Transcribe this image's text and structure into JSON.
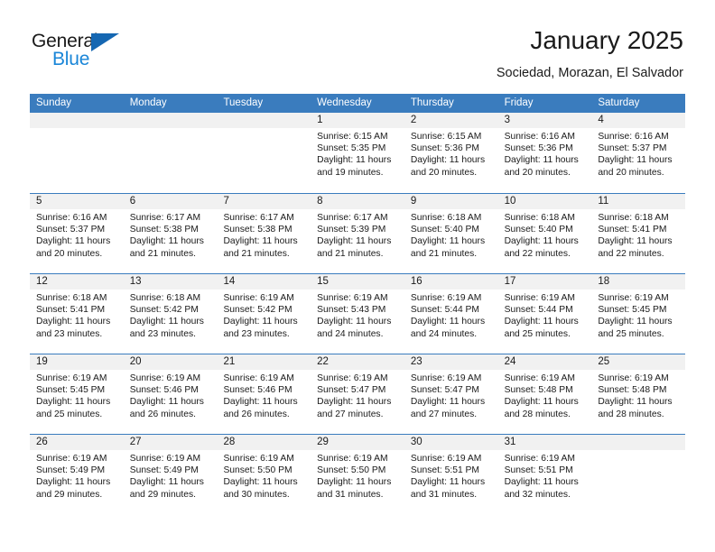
{
  "brand": {
    "name_top": "General",
    "name_bottom": "Blue",
    "triangle_color": "#1567b2",
    "blue_text_color": "#1a86d8"
  },
  "header": {
    "title": "January 2025",
    "subtitle": "Sociedad, Morazan, El Salvador"
  },
  "theme": {
    "header_band_color": "#3a7cbe",
    "daynum_band_color": "#f1f1f1",
    "text_color": "#1a1a1a"
  },
  "calendar": {
    "day_headers": [
      "Sunday",
      "Monday",
      "Tuesday",
      "Wednesday",
      "Thursday",
      "Friday",
      "Saturday"
    ],
    "weeks": [
      [
        {
          "day": "",
          "empty": true,
          "sunrise": "",
          "sunset": "",
          "daylight1": "",
          "daylight2": ""
        },
        {
          "day": "",
          "empty": true,
          "sunrise": "",
          "sunset": "",
          "daylight1": "",
          "daylight2": ""
        },
        {
          "day": "",
          "empty": true,
          "sunrise": "",
          "sunset": "",
          "daylight1": "",
          "daylight2": ""
        },
        {
          "day": "1",
          "empty": false,
          "sunrise": "Sunrise: 6:15 AM",
          "sunset": "Sunset: 5:35 PM",
          "daylight1": "Daylight: 11 hours",
          "daylight2": "and 19 minutes."
        },
        {
          "day": "2",
          "empty": false,
          "sunrise": "Sunrise: 6:15 AM",
          "sunset": "Sunset: 5:36 PM",
          "daylight1": "Daylight: 11 hours",
          "daylight2": "and 20 minutes."
        },
        {
          "day": "3",
          "empty": false,
          "sunrise": "Sunrise: 6:16 AM",
          "sunset": "Sunset: 5:36 PM",
          "daylight1": "Daylight: 11 hours",
          "daylight2": "and 20 minutes."
        },
        {
          "day": "4",
          "empty": false,
          "sunrise": "Sunrise: 6:16 AM",
          "sunset": "Sunset: 5:37 PM",
          "daylight1": "Daylight: 11 hours",
          "daylight2": "and 20 minutes."
        }
      ],
      [
        {
          "day": "5",
          "empty": false,
          "sunrise": "Sunrise: 6:16 AM",
          "sunset": "Sunset: 5:37 PM",
          "daylight1": "Daylight: 11 hours",
          "daylight2": "and 20 minutes."
        },
        {
          "day": "6",
          "empty": false,
          "sunrise": "Sunrise: 6:17 AM",
          "sunset": "Sunset: 5:38 PM",
          "daylight1": "Daylight: 11 hours",
          "daylight2": "and 21 minutes."
        },
        {
          "day": "7",
          "empty": false,
          "sunrise": "Sunrise: 6:17 AM",
          "sunset": "Sunset: 5:38 PM",
          "daylight1": "Daylight: 11 hours",
          "daylight2": "and 21 minutes."
        },
        {
          "day": "8",
          "empty": false,
          "sunrise": "Sunrise: 6:17 AM",
          "sunset": "Sunset: 5:39 PM",
          "daylight1": "Daylight: 11 hours",
          "daylight2": "and 21 minutes."
        },
        {
          "day": "9",
          "empty": false,
          "sunrise": "Sunrise: 6:18 AM",
          "sunset": "Sunset: 5:40 PM",
          "daylight1": "Daylight: 11 hours",
          "daylight2": "and 21 minutes."
        },
        {
          "day": "10",
          "empty": false,
          "sunrise": "Sunrise: 6:18 AM",
          "sunset": "Sunset: 5:40 PM",
          "daylight1": "Daylight: 11 hours",
          "daylight2": "and 22 minutes."
        },
        {
          "day": "11",
          "empty": false,
          "sunrise": "Sunrise: 6:18 AM",
          "sunset": "Sunset: 5:41 PM",
          "daylight1": "Daylight: 11 hours",
          "daylight2": "and 22 minutes."
        }
      ],
      [
        {
          "day": "12",
          "empty": false,
          "sunrise": "Sunrise: 6:18 AM",
          "sunset": "Sunset: 5:41 PM",
          "daylight1": "Daylight: 11 hours",
          "daylight2": "and 23 minutes."
        },
        {
          "day": "13",
          "empty": false,
          "sunrise": "Sunrise: 6:18 AM",
          "sunset": "Sunset: 5:42 PM",
          "daylight1": "Daylight: 11 hours",
          "daylight2": "and 23 minutes."
        },
        {
          "day": "14",
          "empty": false,
          "sunrise": "Sunrise: 6:19 AM",
          "sunset": "Sunset: 5:42 PM",
          "daylight1": "Daylight: 11 hours",
          "daylight2": "and 23 minutes."
        },
        {
          "day": "15",
          "empty": false,
          "sunrise": "Sunrise: 6:19 AM",
          "sunset": "Sunset: 5:43 PM",
          "daylight1": "Daylight: 11 hours",
          "daylight2": "and 24 minutes."
        },
        {
          "day": "16",
          "empty": false,
          "sunrise": "Sunrise: 6:19 AM",
          "sunset": "Sunset: 5:44 PM",
          "daylight1": "Daylight: 11 hours",
          "daylight2": "and 24 minutes."
        },
        {
          "day": "17",
          "empty": false,
          "sunrise": "Sunrise: 6:19 AM",
          "sunset": "Sunset: 5:44 PM",
          "daylight1": "Daylight: 11 hours",
          "daylight2": "and 25 minutes."
        },
        {
          "day": "18",
          "empty": false,
          "sunrise": "Sunrise: 6:19 AM",
          "sunset": "Sunset: 5:45 PM",
          "daylight1": "Daylight: 11 hours",
          "daylight2": "and 25 minutes."
        }
      ],
      [
        {
          "day": "19",
          "empty": false,
          "sunrise": "Sunrise: 6:19 AM",
          "sunset": "Sunset: 5:45 PM",
          "daylight1": "Daylight: 11 hours",
          "daylight2": "and 25 minutes."
        },
        {
          "day": "20",
          "empty": false,
          "sunrise": "Sunrise: 6:19 AM",
          "sunset": "Sunset: 5:46 PM",
          "daylight1": "Daylight: 11 hours",
          "daylight2": "and 26 minutes."
        },
        {
          "day": "21",
          "empty": false,
          "sunrise": "Sunrise: 6:19 AM",
          "sunset": "Sunset: 5:46 PM",
          "daylight1": "Daylight: 11 hours",
          "daylight2": "and 26 minutes."
        },
        {
          "day": "22",
          "empty": false,
          "sunrise": "Sunrise: 6:19 AM",
          "sunset": "Sunset: 5:47 PM",
          "daylight1": "Daylight: 11 hours",
          "daylight2": "and 27 minutes."
        },
        {
          "day": "23",
          "empty": false,
          "sunrise": "Sunrise: 6:19 AM",
          "sunset": "Sunset: 5:47 PM",
          "daylight1": "Daylight: 11 hours",
          "daylight2": "and 27 minutes."
        },
        {
          "day": "24",
          "empty": false,
          "sunrise": "Sunrise: 6:19 AM",
          "sunset": "Sunset: 5:48 PM",
          "daylight1": "Daylight: 11 hours",
          "daylight2": "and 28 minutes."
        },
        {
          "day": "25",
          "empty": false,
          "sunrise": "Sunrise: 6:19 AM",
          "sunset": "Sunset: 5:48 PM",
          "daylight1": "Daylight: 11 hours",
          "daylight2": "and 28 minutes."
        }
      ],
      [
        {
          "day": "26",
          "empty": false,
          "sunrise": "Sunrise: 6:19 AM",
          "sunset": "Sunset: 5:49 PM",
          "daylight1": "Daylight: 11 hours",
          "daylight2": "and 29 minutes."
        },
        {
          "day": "27",
          "empty": false,
          "sunrise": "Sunrise: 6:19 AM",
          "sunset": "Sunset: 5:49 PM",
          "daylight1": "Daylight: 11 hours",
          "daylight2": "and 29 minutes."
        },
        {
          "day": "28",
          "empty": false,
          "sunrise": "Sunrise: 6:19 AM",
          "sunset": "Sunset: 5:50 PM",
          "daylight1": "Daylight: 11 hours",
          "daylight2": "and 30 minutes."
        },
        {
          "day": "29",
          "empty": false,
          "sunrise": "Sunrise: 6:19 AM",
          "sunset": "Sunset: 5:50 PM",
          "daylight1": "Daylight: 11 hours",
          "daylight2": "and 31 minutes."
        },
        {
          "day": "30",
          "empty": false,
          "sunrise": "Sunrise: 6:19 AM",
          "sunset": "Sunset: 5:51 PM",
          "daylight1": "Daylight: 11 hours",
          "daylight2": "and 31 minutes."
        },
        {
          "day": "31",
          "empty": false,
          "sunrise": "Sunrise: 6:19 AM",
          "sunset": "Sunset: 5:51 PM",
          "daylight1": "Daylight: 11 hours",
          "daylight2": "and 32 minutes."
        },
        {
          "day": "",
          "empty": true,
          "sunrise": "",
          "sunset": "",
          "daylight1": "",
          "daylight2": ""
        }
      ]
    ]
  }
}
